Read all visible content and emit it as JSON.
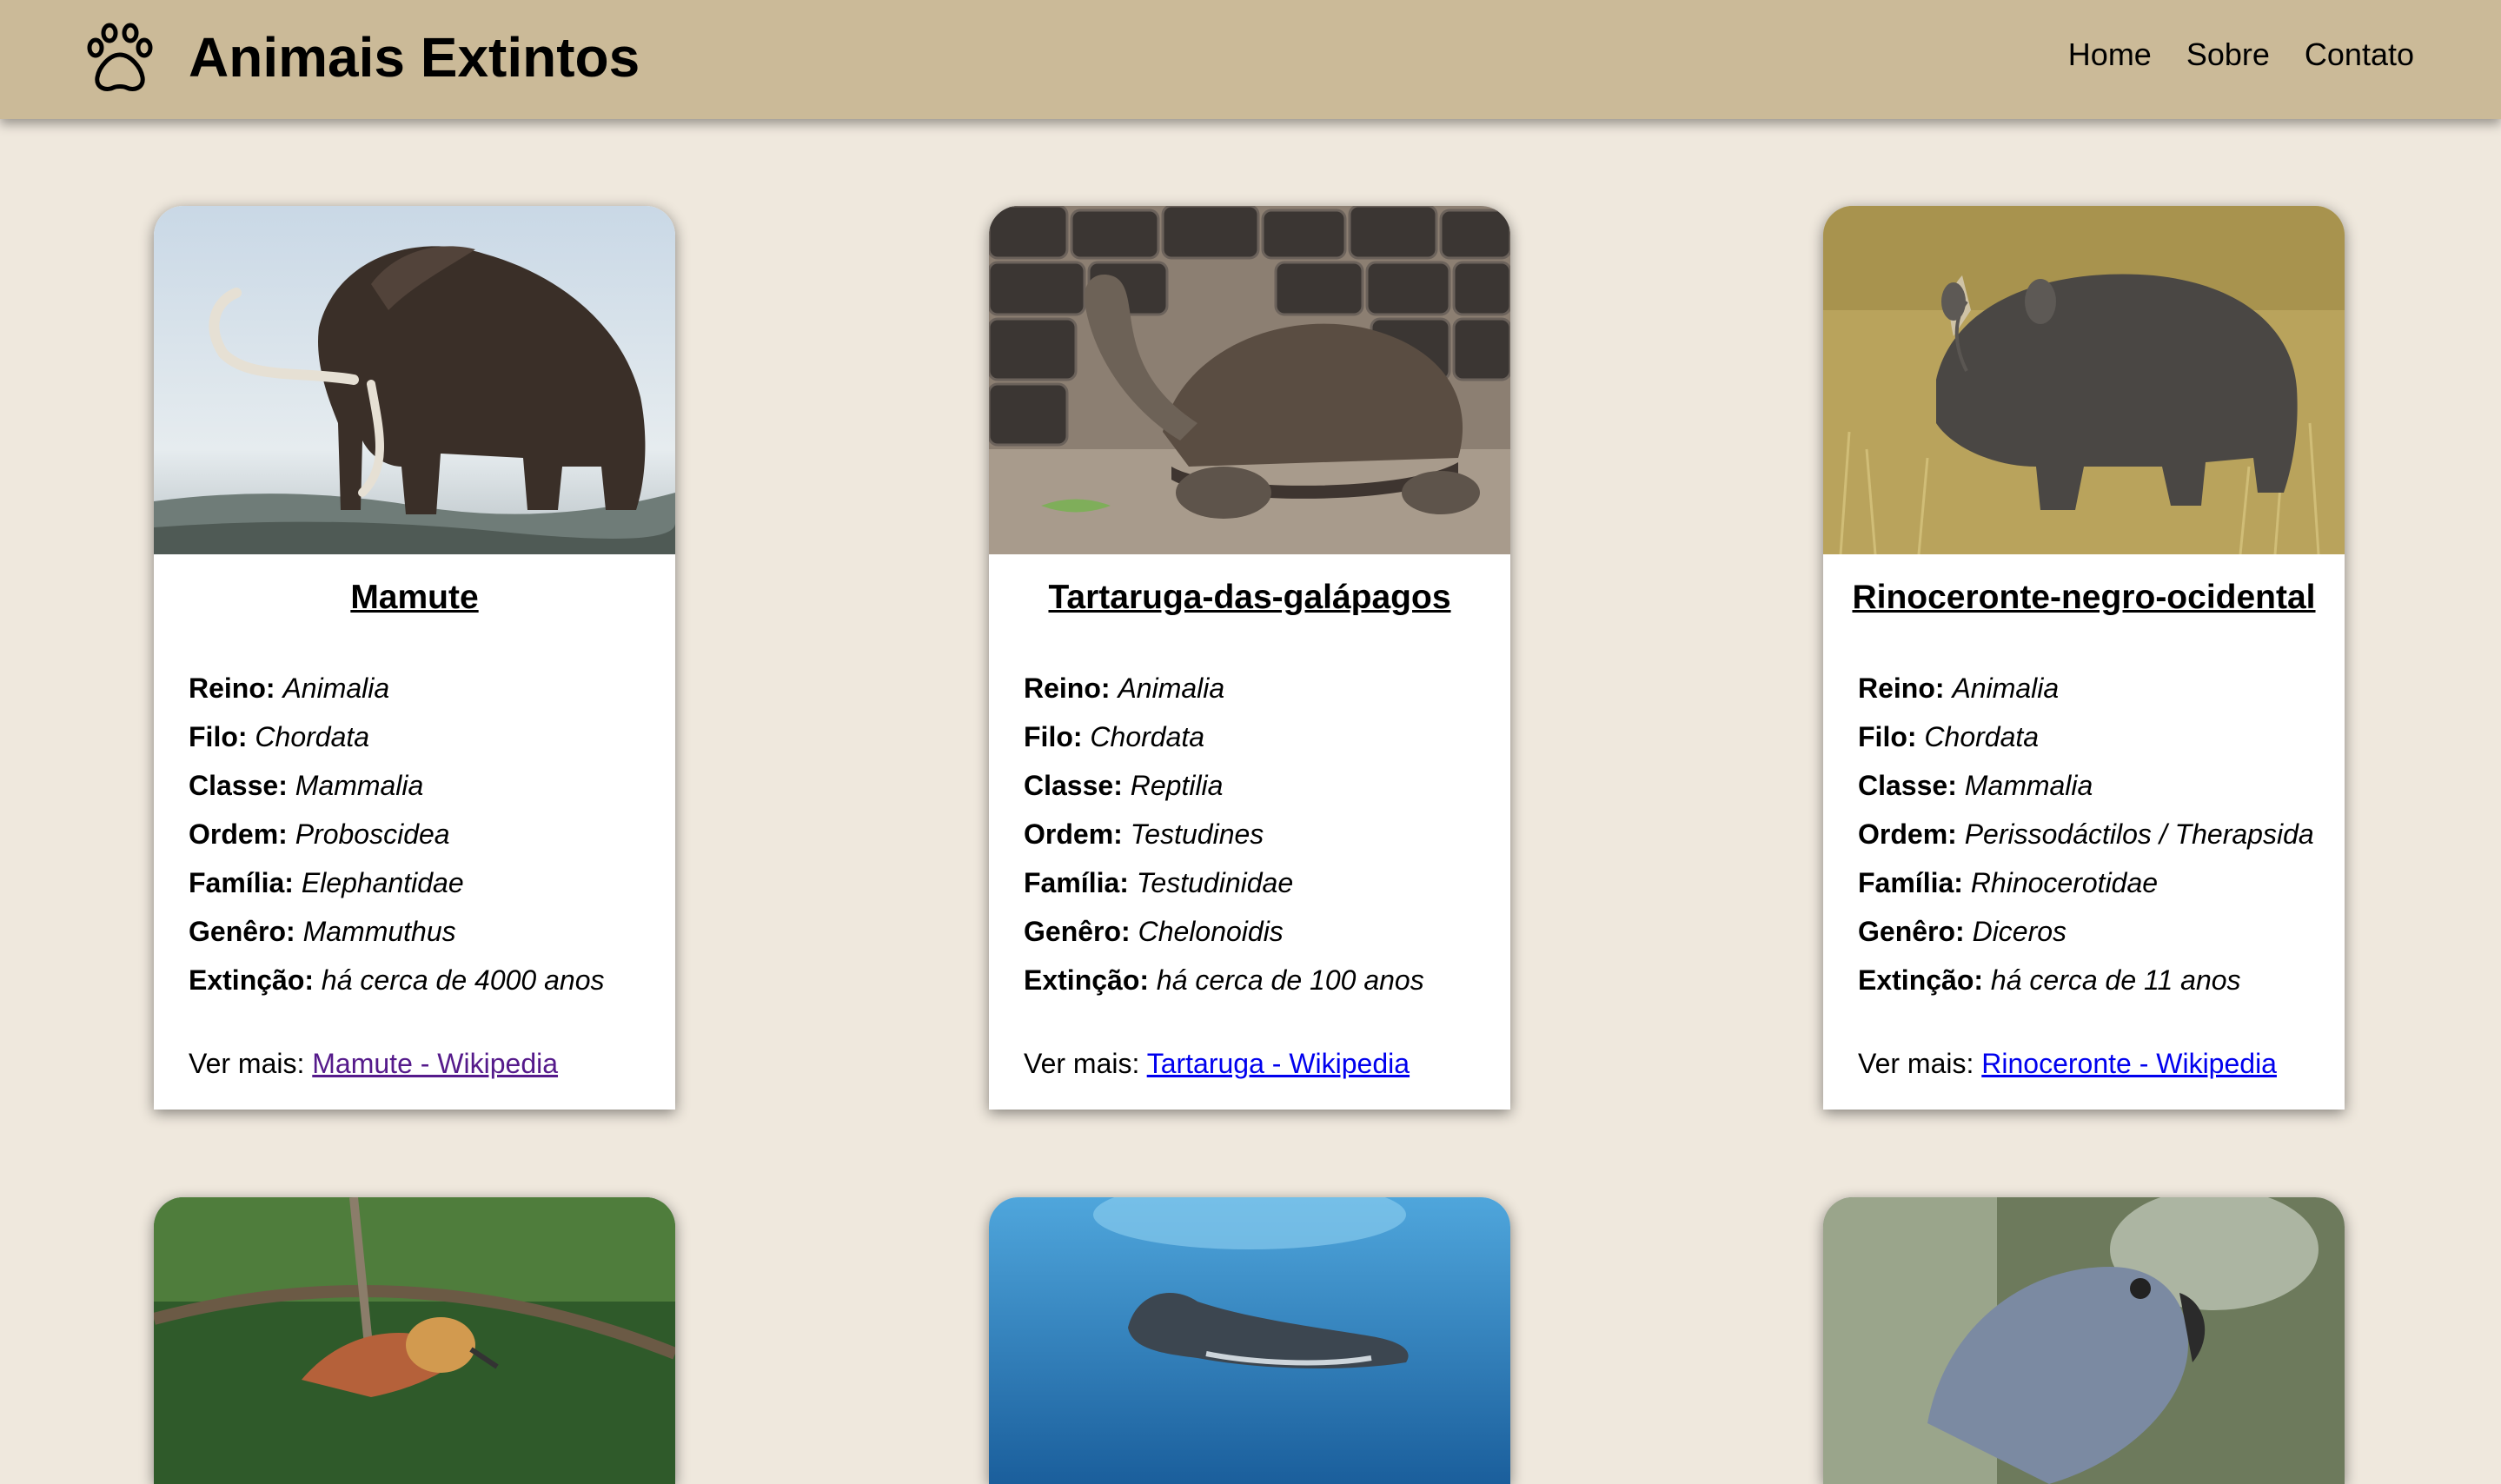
{
  "header": {
    "logo_icon": "paw-icon",
    "title": "Animais Extintos",
    "nav": [
      "Home",
      "Sobre",
      "Contato"
    ],
    "background": "#cbba98"
  },
  "page": {
    "background": "#efe8dd"
  },
  "labels": {
    "reino": "Reino:",
    "filo": "Filo:",
    "classe": "Classe:",
    "ordem": "Ordem:",
    "familia": "Família:",
    "genero": "Genêro:",
    "extincao": "Extinção:",
    "ver_mais": "Ver mais:"
  },
  "cards": [
    {
      "name": "Mamute",
      "image": "woolly-mammoth-photo",
      "reino": "Animalia",
      "filo": "Chordata",
      "classe": "Mammalia",
      "ordem": "Proboscidea",
      "familia": "Elephantidae",
      "genero": "Mammuthus",
      "extincao": "há cerca de 4000 anos",
      "link": "Mamute - Wikipedia",
      "link_color": "#551a8b"
    },
    {
      "name": "Tartaruga-das-galápagos",
      "image": "galapagos-tortoise-photo",
      "reino": "Animalia",
      "filo": "Chordata",
      "classe": "Reptilia",
      "ordem": "Testudines",
      "familia": "Testudinidae",
      "genero": "Chelonoidis",
      "extincao": "há cerca de 100 anos",
      "link": "Tartaruga - Wikipedia",
      "link_color": "#0000ee"
    },
    {
      "name": "Rinoceronte-negro-ocidental",
      "image": "black-rhino-photo",
      "reino": "Animalia",
      "filo": "Chordata",
      "classe": "Mammalia",
      "ordem": "Perissodáctilos / Therapsida",
      "familia": "Rhinocerotidae",
      "genero": "Diceros",
      "extincao": "há cerca de 11 anos",
      "link": "Rinoceronte - Wikipedia",
      "link_color": "#0000ee"
    },
    {
      "image": "bird-photo"
    },
    {
      "image": "monk-seal-photo"
    },
    {
      "image": "grey-parrot-photo"
    }
  ]
}
